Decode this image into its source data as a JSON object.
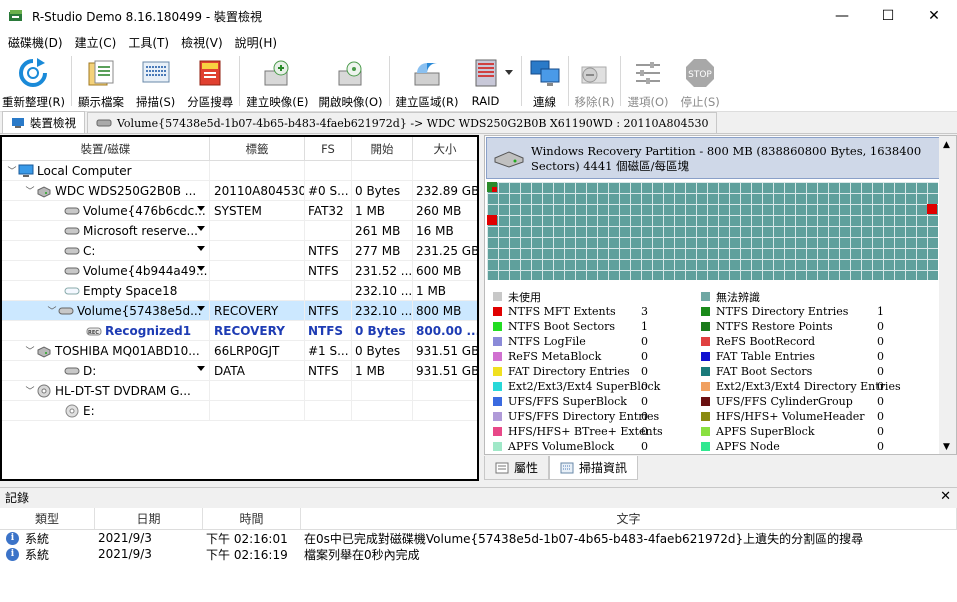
{
  "window": {
    "title": "R-Studio Demo 8.16.180499 - 裝置檢視",
    "minimize": "—",
    "maximize": "☐",
    "close": "✕"
  },
  "menu": [
    "磁碟機(D)",
    "建立(C)",
    "工具(T)",
    "檢視(V)",
    "說明(H)"
  ],
  "toolbar": {
    "refresh": "重新整理(R)",
    "show_files": "顯示檔案",
    "scan": "掃描(S)",
    "partition_search": "分區搜尋",
    "create_image": "建立映像(E)",
    "open_image": "開啟映像(O)",
    "create_region": "建立區域(R)",
    "raid": "RAID",
    "connect": "連線",
    "remove": "移除(R)",
    "options": "選項(O)",
    "stop": "停止(S)",
    "stop_icon_text": "STOP"
  },
  "tabs": {
    "device_view": "裝置檢視",
    "breadcrumb": "Volume{57438e5d-1b07-4b65-b483-4faeb621972d} -> WDC WDS250G2B0B X61190WD : 20110A804530"
  },
  "tree": {
    "headers": [
      "裝置/磁碟",
      "標籤",
      "FS",
      "開始",
      "大小"
    ],
    "rows": [
      {
        "name": "Local Computer",
        "label": "",
        "fs": "",
        "start": "",
        "size": ""
      },
      {
        "name": "WDC WDS250G2B0B ...",
        "label": "20110A804530",
        "fs": "#0 S...",
        "start": "0 Bytes",
        "size": "232.89 GB"
      },
      {
        "name": "Volume{476b6cdc...",
        "label": "SYSTEM",
        "fs": "FAT32",
        "start": "1 MB",
        "size": "260 MB"
      },
      {
        "name": "Microsoft reserve...",
        "label": "",
        "fs": "",
        "start": "261 MB",
        "size": "16 MB"
      },
      {
        "name": "C:",
        "label": "",
        "fs": "NTFS",
        "start": "277 MB",
        "size": "231.25 GB"
      },
      {
        "name": "Volume{4b944a49...",
        "label": "",
        "fs": "NTFS",
        "start": "231.52 ...",
        "size": "600 MB"
      },
      {
        "name": "Empty Space18",
        "label": "",
        "fs": "",
        "start": "232.10 ...",
        "size": "1 MB"
      },
      {
        "name": "Volume{57438e5d...",
        "label": "RECOVERY",
        "fs": "NTFS",
        "start": "232.10 ...",
        "size": "800 MB"
      },
      {
        "name": "Recognized1",
        "label": "RECOVERY",
        "fs": "NTFS",
        "start": "0 Bytes",
        "size": "800.00 ..."
      },
      {
        "name": "TOSHIBA MQ01ABD10...",
        "label": "66LRP0GJT",
        "fs": "#1 S...",
        "start": "0 Bytes",
        "size": "931.51 GB"
      },
      {
        "name": "D:",
        "label": "DATA",
        "fs": "NTFS",
        "start": "1 MB",
        "size": "931.51 GB"
      },
      {
        "name": "HL-DT-ST DVDRAM G...",
        "label": "",
        "fs": "",
        "start": "",
        "size": ""
      },
      {
        "name": "E:",
        "label": "",
        "fs": "",
        "start": "",
        "size": ""
      }
    ]
  },
  "partition_panel": {
    "header": "Windows Recovery Partition - 800 MB (838860800 Bytes, 1638400 Sectors) 4441 個磁區/每區塊",
    "colors": {
      "grid": "#5fa09c",
      "red": "#e00000"
    },
    "legend": [
      {
        "label": "未使用",
        "count": "",
        "color": "#c8c8c8"
      },
      {
        "label": "無法辨識",
        "count": "",
        "color": "#6fa7a3"
      },
      {
        "label": "NTFS MFT Extents",
        "count": "3",
        "color": "#e00000"
      },
      {
        "label": "NTFS Directory Entries",
        "count": "1",
        "color": "#1a8a1a"
      },
      {
        "label": "NTFS Boot Sectors",
        "count": "1",
        "color": "#22dd22"
      },
      {
        "label": "NTFS Restore Points",
        "count": "0",
        "color": "#1a7a1a"
      },
      {
        "label": "NTFS LogFile",
        "count": "0",
        "color": "#8a8ad8"
      },
      {
        "label": "ReFS BootRecord",
        "count": "0",
        "color": "#e04040"
      },
      {
        "label": "ReFS MetaBlock",
        "count": "0",
        "color": "#d070d0"
      },
      {
        "label": "FAT Table Entries",
        "count": "0",
        "color": "#1010d0"
      },
      {
        "label": "FAT Directory Entries",
        "count": "0",
        "color": "#f0e020"
      },
      {
        "label": "FAT Boot Sectors",
        "count": "0",
        "color": "#1a7a7a"
      },
      {
        "label": "Ext2/Ext3/Ext4 SuperBlock",
        "count": "0",
        "color": "#28d8d8"
      },
      {
        "label": "Ext2/Ext3/Ext4 Directory Entries",
        "count": "0",
        "color": "#f0a060"
      },
      {
        "label": "UFS/FFS SuperBlock",
        "count": "0",
        "color": "#3a6ae0"
      },
      {
        "label": "UFS/FFS CylinderGroup",
        "count": "0",
        "color": "#6a1010"
      },
      {
        "label": "UFS/FFS Directory Entries",
        "count": "0",
        "color": "#b09ad8"
      },
      {
        "label": "HFS/HFS+ VolumeHeader",
        "count": "0",
        "color": "#8a8a10"
      },
      {
        "label": "HFS/HFS+ BTree+ Extents",
        "count": "0",
        "color": "#e84888"
      },
      {
        "label": "APFS SuperBlock",
        "count": "0",
        "color": "#8ae040"
      },
      {
        "label": "APFS VolumeBlock",
        "count": "0",
        "color": "#a0e8c8"
      },
      {
        "label": "APFS Node",
        "count": "0",
        "color": "#30e890"
      }
    ],
    "tabs": [
      "屬性",
      "掃描資訊"
    ]
  },
  "log": {
    "title": "記錄",
    "headers": [
      "類型",
      "日期",
      "時間",
      "文字"
    ],
    "rows": [
      {
        "type": "系統",
        "date": "2021/9/3",
        "time": "下午 02:16:01",
        "text": "在0s中已完成對磁碟機Volume{57438e5d-1b07-4b65-b483-4faeb621972d}上遺失的分割區的搜尋"
      },
      {
        "type": "系統",
        "date": "2021/9/3",
        "time": "下午 02:16:19",
        "text": "檔案列舉在0秒內完成"
      }
    ]
  }
}
